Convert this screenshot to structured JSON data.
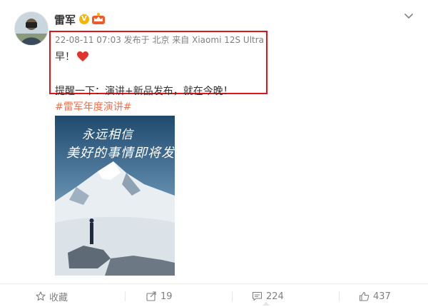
{
  "post": {
    "username": "雷军",
    "meta": "22-08-11 07:03 发布于 北京 来自 Xiaomi 12S Ultra",
    "line1": "早！",
    "line2": "提醒一下：演讲+新品发布，就在今晚！",
    "hashtag": "#雷军年度演讲#"
  },
  "badges": {
    "verified": "V"
  },
  "image": {
    "text_line1": "永远相信",
    "text_line2": "美好的事情即将发生"
  },
  "actions": {
    "favorite_label": "收藏",
    "forward_count": "19",
    "comment_count": "224",
    "like_count": "437"
  },
  "icons": [
    "avatar",
    "verified-v-icon",
    "crown-icon",
    "chevron-down-icon",
    "heart-icon",
    "star-icon",
    "forward-icon",
    "comment-icon",
    "thumbs-up-icon"
  ],
  "colors": {
    "highlight_border": "#e3131a",
    "hashtag": "#eb7350",
    "meta_text": "#808080",
    "verified": "#f7b500"
  }
}
